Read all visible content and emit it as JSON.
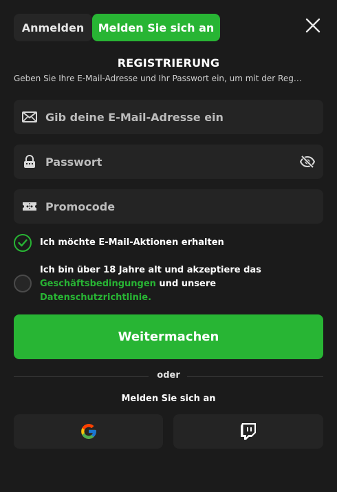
{
  "tabs": {
    "login_label": "Anmelden",
    "register_label": "Melden Sie sich an"
  },
  "header": {
    "title": "REGISTRIERUNG",
    "subtitle": "Geben Sie Ihre E-Mail-Adresse und Ihr Passwort ein, um mit der Reg…"
  },
  "form": {
    "email_placeholder": "Gib deine E-Mail-Adresse ein",
    "password_placeholder": "Passwort",
    "promo_placeholder": "Promocode",
    "email_actions_label": "Ich möchte E-Mail-Aktionen erhalten",
    "email_actions_checked": true,
    "terms_prefix": "Ich bin über 18 Jahre alt und akzeptiere das",
    "terms_link": "Geschäftsbedingungen",
    "terms_middle": " und unsere",
    "privacy_link": "Datenschutzrichtlinie.",
    "terms_checked": false,
    "submit_label": "Weitermachen"
  },
  "divider": {
    "label": "oder"
  },
  "social": {
    "title": "Melden Sie sich an",
    "providers": [
      "google",
      "twitch"
    ]
  },
  "colors": {
    "accent": "#28b534",
    "background": "#1b1b1b",
    "field": "#242424"
  },
  "icons": [
    "close-icon",
    "mail-icon",
    "lock-icon",
    "eye-off-icon",
    "ticket-icon",
    "check-icon",
    "google-icon",
    "twitch-icon"
  ]
}
